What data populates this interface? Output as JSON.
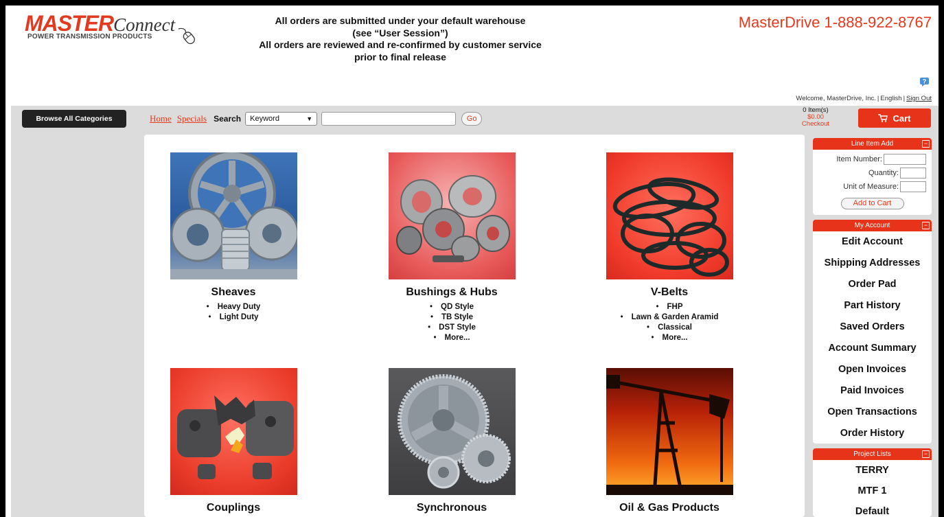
{
  "header": {
    "logo_master": "MASTER",
    "logo_connect": "Connect",
    "logo_sub": "POWER TRANSMISSION PRODUCTS",
    "notice_line1": "All orders are submitted under your default warehouse",
    "notice_line2": "(see “User Session”)",
    "notice_line3": "All orders are reviewed and re-confirmed by customer service",
    "notice_line4": "prior to final release",
    "phone": "MasterDrive 1-888-922-8767",
    "welcome": "Welcome, MasterDrive, Inc.",
    "language": "English",
    "sign_out": "Sign Out"
  },
  "toolbar": {
    "browse_label": "Browse All Categories",
    "home_label": "Home",
    "specials_label": "Specials",
    "search_label": "Search",
    "keyword_selected": "Keyword",
    "search_value": "",
    "go_label": "Go",
    "cart_count": "0 Item(s)",
    "cart_total": "$0.00",
    "checkout_label": "Checkout",
    "cart_label": "Cart"
  },
  "categories": [
    {
      "title": "Sheaves",
      "items": [
        "Heavy Duty",
        "Light Duty"
      ]
    },
    {
      "title": "Bushings & Hubs",
      "items": [
        "QD Style",
        "TB Style",
        "DST Style",
        "More..."
      ]
    },
    {
      "title": "V-Belts",
      "items": [
        "FHP",
        "Lawn & Garden Aramid",
        "Classical",
        "More..."
      ]
    },
    {
      "title": "Couplings",
      "items": []
    },
    {
      "title": "Synchronous",
      "items": []
    },
    {
      "title": "Oil & Gas Products",
      "items": []
    }
  ],
  "line_item_add": {
    "title": "Line Item Add",
    "item_number_label": "Item Number:",
    "quantity_label": "Quantity:",
    "uom_label": "Unit of Measure:",
    "add_to_cart_label": "Add to Cart"
  },
  "my_account": {
    "title": "My Account",
    "items": [
      "Edit Account",
      "Shipping Addresses",
      "Order Pad",
      "Part History",
      "Saved Orders",
      "Account Summary",
      "Open Invoices",
      "Paid Invoices",
      "Open Transactions",
      "Order History"
    ]
  },
  "project_lists": {
    "title": "Project Lists",
    "items": [
      "TERRY",
      "MTF 1",
      "Default"
    ]
  },
  "colors": {
    "accent": "#e8331b",
    "band": "#dcdcdc",
    "browse_button": "#222222"
  }
}
